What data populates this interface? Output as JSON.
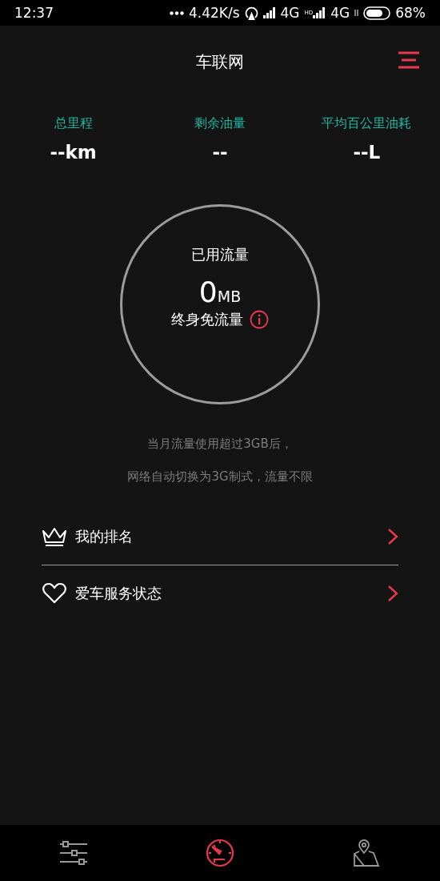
{
  "status_bar": {
    "time": "12:37",
    "speed": "4.42K/s",
    "network_1": "4G",
    "hd": "HD",
    "network_2": "4G",
    "battery": "68%"
  },
  "header": {
    "title": "车联网"
  },
  "stats": [
    {
      "label": "总里程",
      "value": "--km"
    },
    {
      "label": "剩余油量",
      "value": "--"
    },
    {
      "label": "平均百公里油耗",
      "value": "--L"
    }
  ],
  "usage": {
    "title": "已用流量",
    "amount": "0",
    "unit": "MB",
    "plan": "终身免流量"
  },
  "notes": [
    "当月流量使用超过3GB后，",
    "网络自动切换为3G制式，流量不限"
  ],
  "menu": [
    {
      "kind": "crown",
      "label": "我的排名"
    },
    {
      "kind": "heart",
      "label": "爱车服务状态"
    }
  ],
  "bottom_nav": [
    {
      "kind": "sliders",
      "selected": false
    },
    {
      "kind": "gauge",
      "selected": true
    },
    {
      "kind": "map",
      "selected": false
    }
  ]
}
